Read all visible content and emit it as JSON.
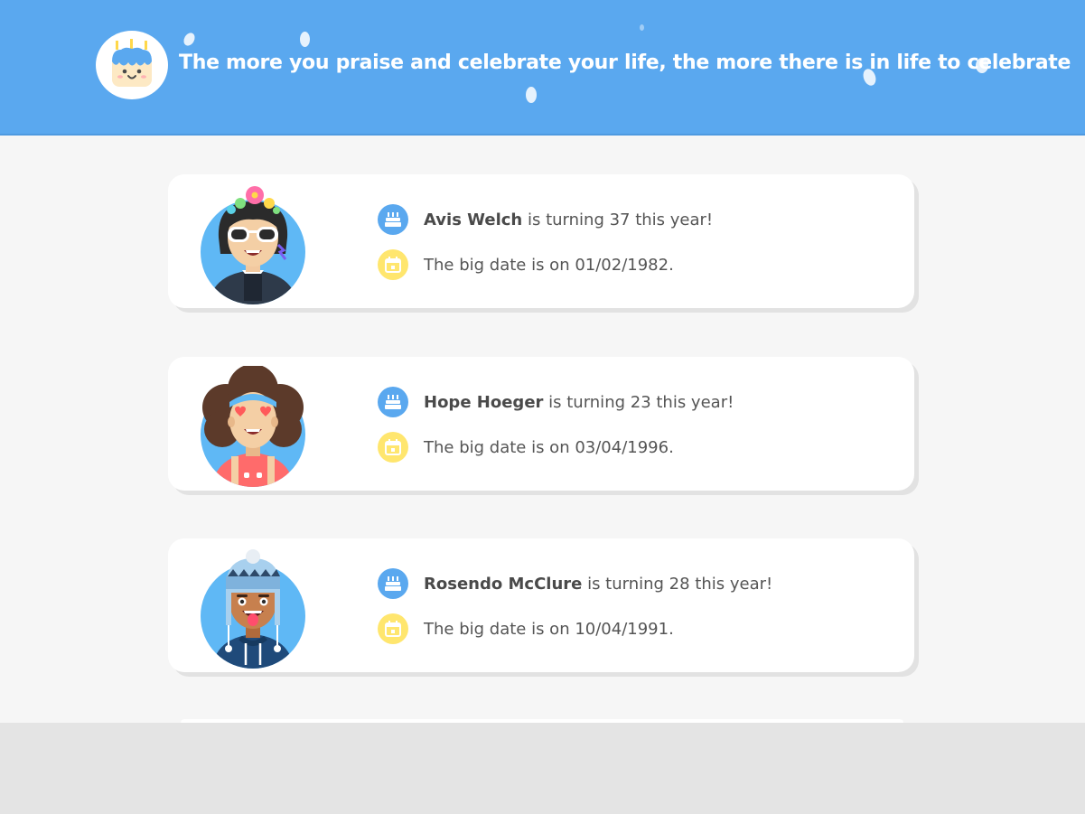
{
  "header": {
    "quote": "The more you praise and celebrate your life, the more there is in life to celebrate",
    "logo_icon": "birthday-cake-face-icon",
    "background_color": "#5aa8ef"
  },
  "birthdays": [
    {
      "name": "Avis Welch",
      "age_text": " is turning 37 this year!",
      "date_text": "The big date is on 01/02/1982.",
      "avatar": "woman-flower-crown-sunglasses-avatar"
    },
    {
      "name": "Hope Hoeger",
      "age_text": " is turning 23 this year!",
      "date_text": "The big date is on 03/04/1996.",
      "avatar": "woman-curly-hair-heart-eyes-avatar"
    },
    {
      "name": "Rosendo McClure",
      "age_text": " is turning 28 this year!",
      "date_text": "The big date is on 10/04/1991.",
      "avatar": "man-beanie-tongue-out-avatar"
    }
  ],
  "icons": {
    "age": "cake-icon",
    "date": "calendar-icon"
  },
  "colors": {
    "accent_blue": "#5aa8ef",
    "accent_yellow": "#ffe66e",
    "card_background": "#ffffff",
    "page_background": "#f6f6f6"
  }
}
